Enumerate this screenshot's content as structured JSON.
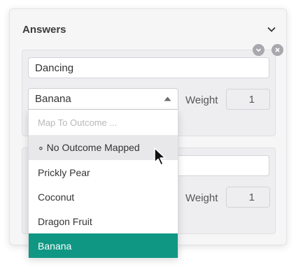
{
  "panel": {
    "title": "Answers"
  },
  "answers": [
    {
      "text": "Dancing",
      "outcome": "Banana",
      "weight_label": "Weight",
      "weight": "1"
    },
    {
      "text": "",
      "weight_label": "Weight",
      "weight": "1"
    }
  ],
  "dropdown": {
    "placeholder": "Map To Outcome ...",
    "options": [
      "∘ No Outcome Mapped",
      "Prickly Pear",
      "Coconut",
      "Dragon Fruit",
      "Banana"
    ],
    "hovered": "∘ No Outcome Mapped",
    "selected": "Banana"
  },
  "colors": {
    "accent": "#0f9784",
    "panel_bg": "#f6f6f7",
    "card_bg": "#eeeef0",
    "icon_gray": "#a8a8ae"
  },
  "icons": [
    "chevron-down-icon",
    "close-icon",
    "caret-up-icon",
    "mouse-pointer-icon"
  ]
}
